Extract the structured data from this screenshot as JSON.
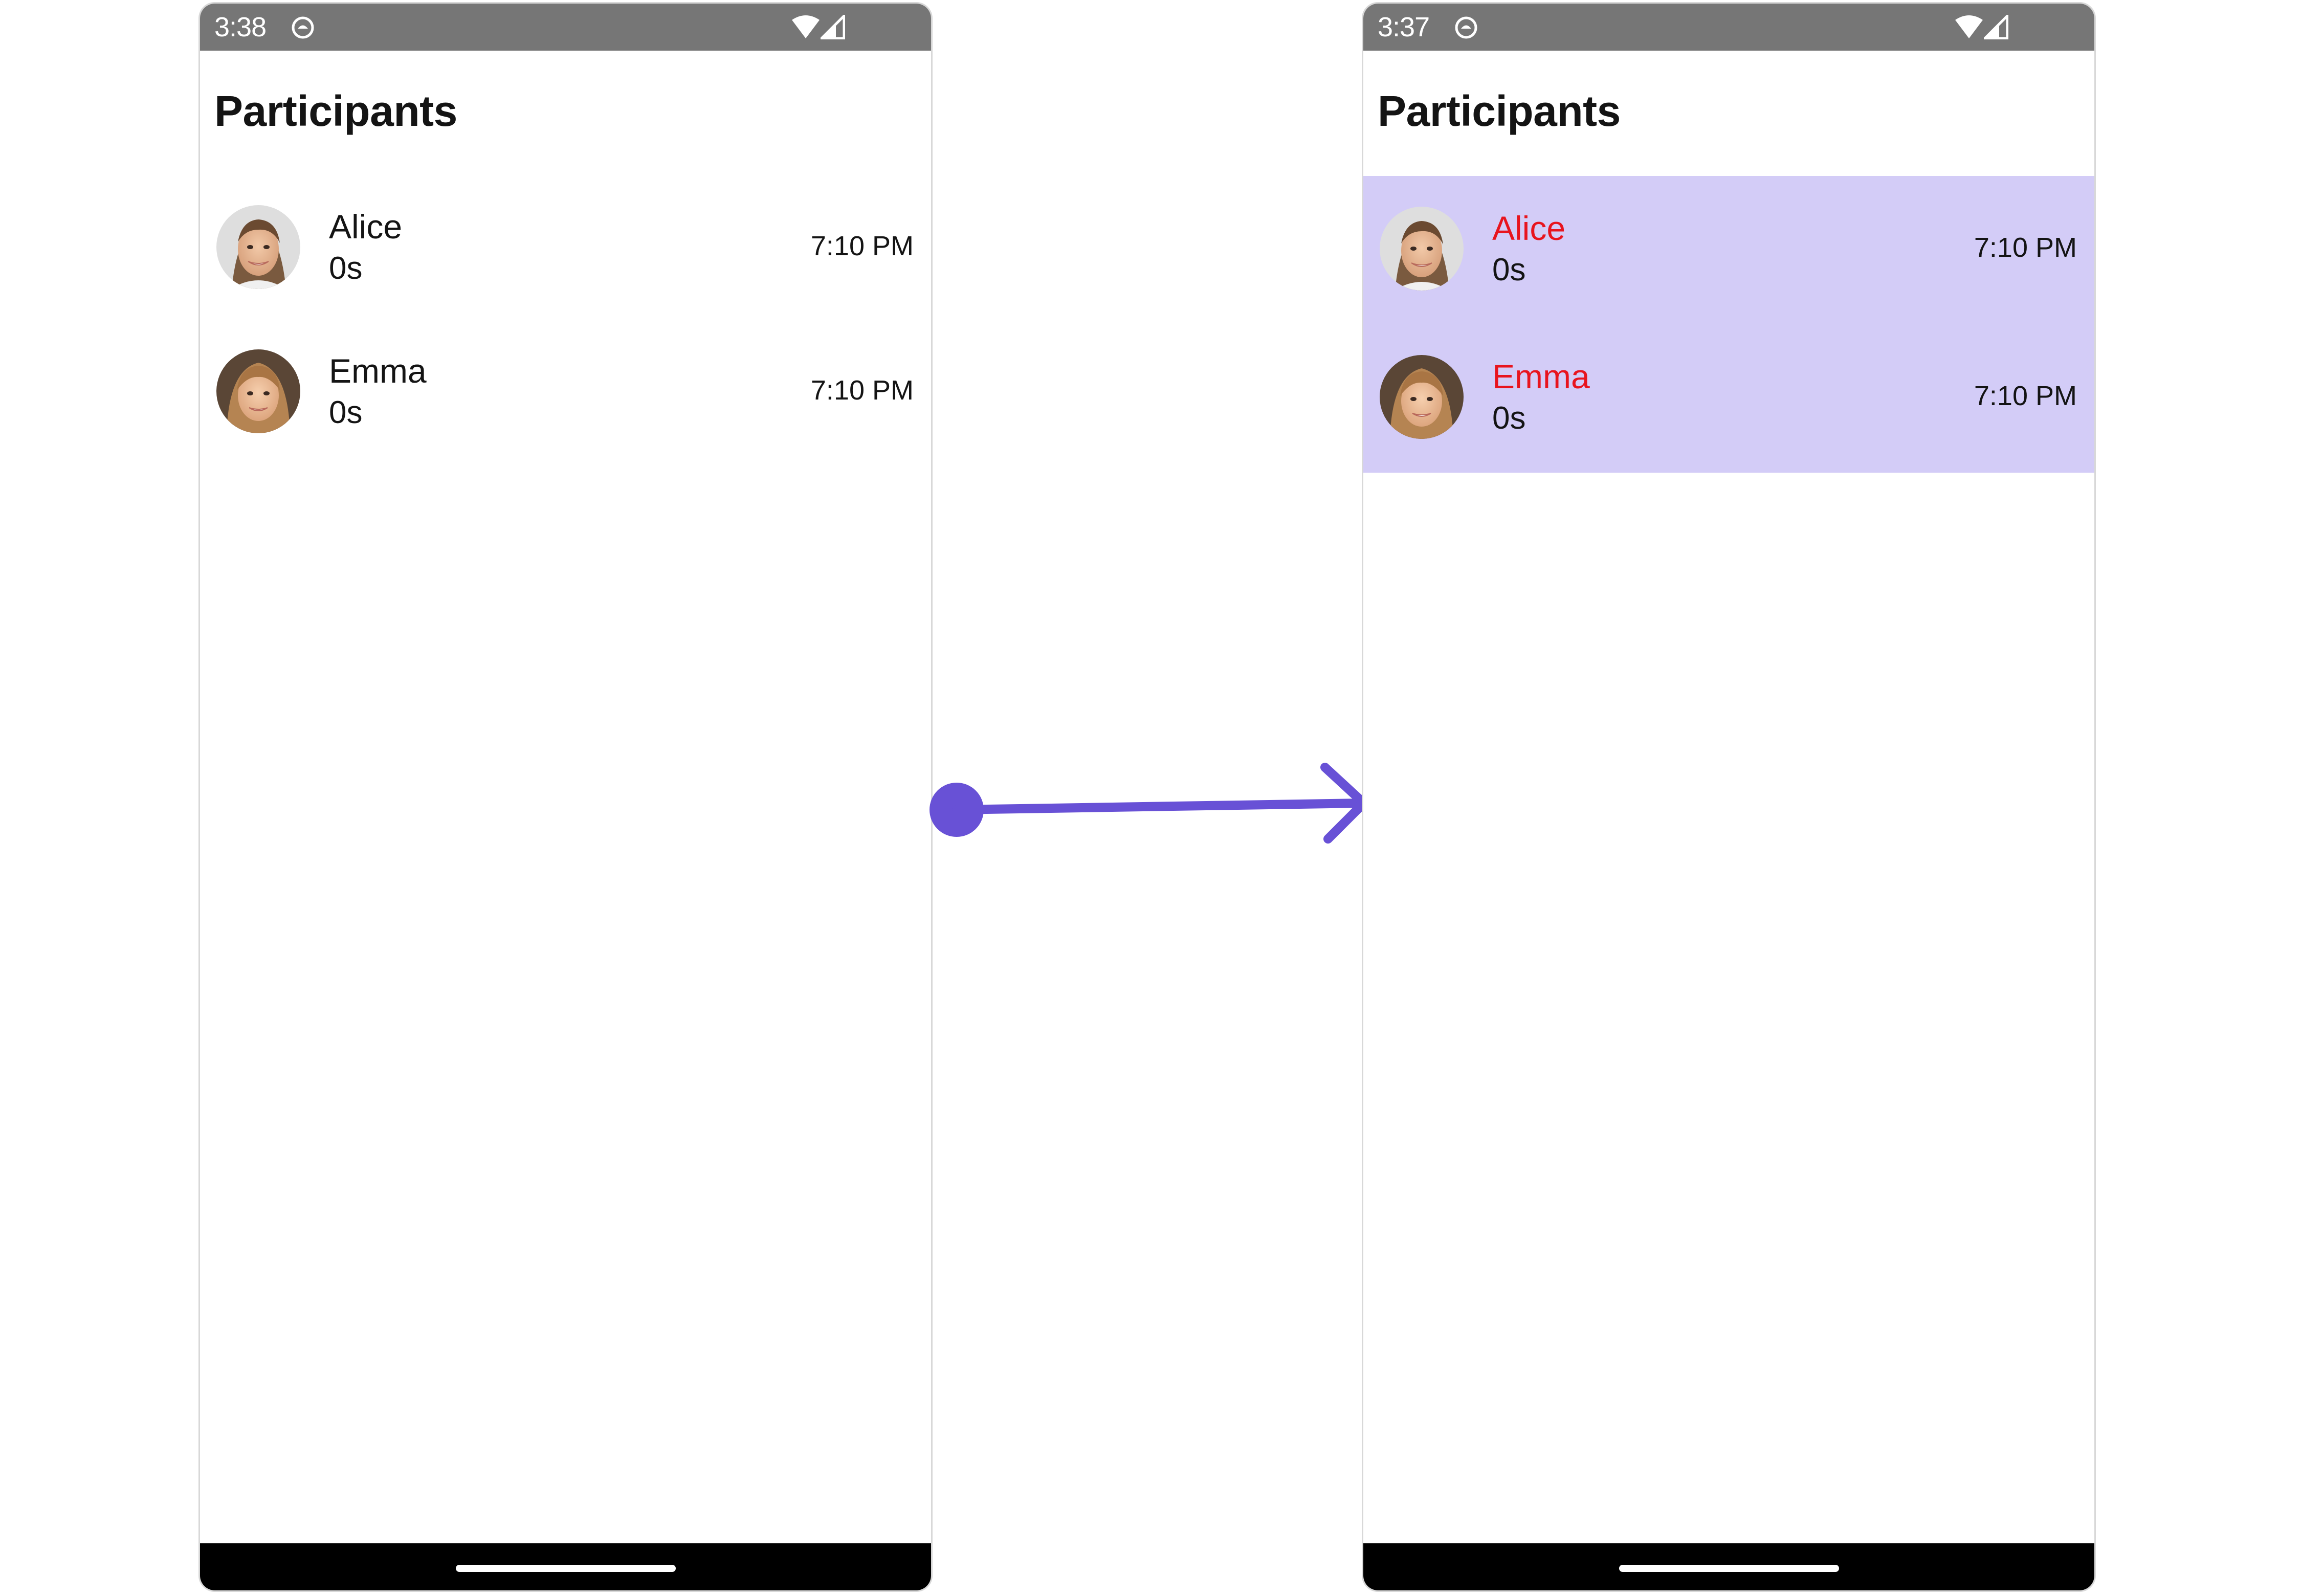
{
  "colors": {
    "status_bar": "#767676",
    "highlight_background": "#d3ccf7",
    "highlight_name_text": "#e8141e",
    "arrow": "#6851d6"
  },
  "screens": [
    {
      "status_bar": {
        "time": "3:38"
      },
      "title": "Participants",
      "participants": [
        {
          "name": "Alice",
          "duration": "0s",
          "time": "7:10 PM"
        },
        {
          "name": "Emma",
          "duration": "0s",
          "time": "7:10 PM"
        }
      ]
    },
    {
      "status_bar": {
        "time": "3:37"
      },
      "title": "Participants",
      "participants": [
        {
          "name": "Alice",
          "duration": "0s",
          "time": "7:10 PM"
        },
        {
          "name": "Emma",
          "duration": "0s",
          "time": "7:10 PM"
        }
      ]
    }
  ],
  "icons": {
    "status_app": "app-notification-icon",
    "wifi": "wifi-icon",
    "signal": "cell-signal-icon",
    "transition": "right-arrow-icon"
  }
}
